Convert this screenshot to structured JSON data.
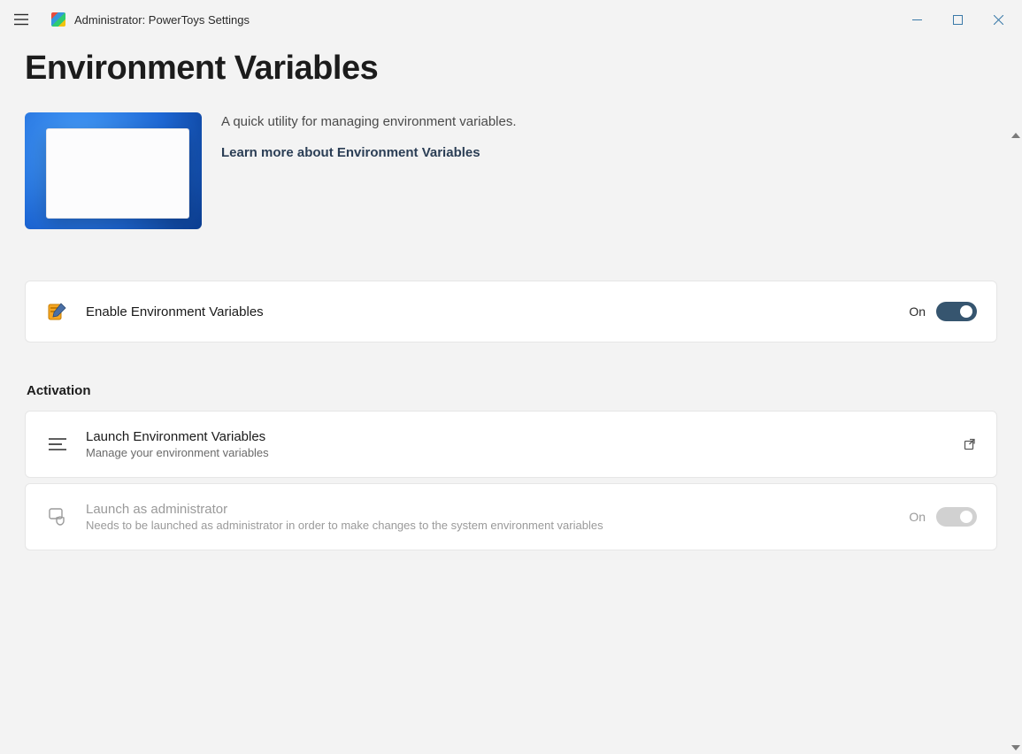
{
  "window": {
    "title": "Administrator: PowerToys Settings"
  },
  "page": {
    "heading": "Environment Variables",
    "description": "A quick utility for managing environment variables.",
    "learn_more": "Learn more about Environment Variables"
  },
  "enable_card": {
    "title": "Enable Environment Variables",
    "toggle_state": "On"
  },
  "sections": {
    "activation_label": "Activation"
  },
  "launch_card": {
    "title": "Launch Environment Variables",
    "subtitle": "Manage your environment variables"
  },
  "admin_card": {
    "title": "Launch as administrator",
    "subtitle": "Needs to be launched as administrator in order to make changes to the system environment variables",
    "toggle_state": "On"
  }
}
